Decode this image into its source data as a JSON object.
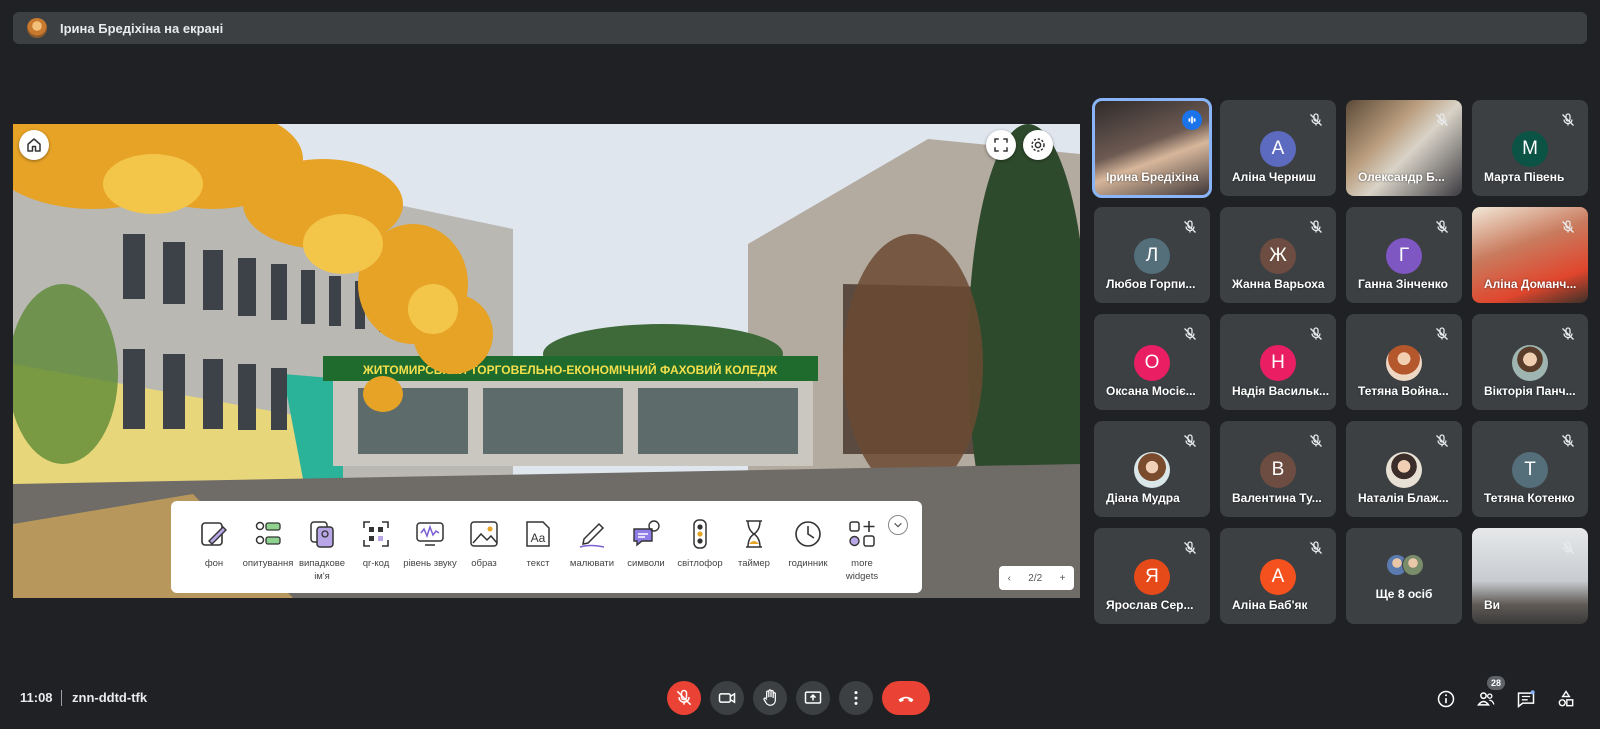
{
  "banner": {
    "presenter_text": "Ірина Бредіхіна на екрані"
  },
  "presentation": {
    "building_sign": "ЖИТОМИРСЬКИЙ ТОРГОВЕЛЬНО-ЕКОНОМІЧНИЙ ФАХОВИЙ КОЛЕДЖ",
    "toolbar": [
      {
        "label": "фон",
        "icon": "background-edit-icon"
      },
      {
        "label": "опитування",
        "icon": "poll-icon"
      },
      {
        "label": "випадкове ім'я",
        "icon": "random-name-icon"
      },
      {
        "label": "qr-код",
        "icon": "qr-code-icon"
      },
      {
        "label": "рівень звуку",
        "icon": "sound-level-icon"
      },
      {
        "label": "образ",
        "icon": "image-icon"
      },
      {
        "label": "текст",
        "icon": "text-icon"
      },
      {
        "label": "малювати",
        "icon": "draw-icon"
      },
      {
        "label": "символи",
        "icon": "symbols-icon"
      },
      {
        "label": "світлофор",
        "icon": "traffic-light-icon"
      },
      {
        "label": "таймер",
        "icon": "hourglass-icon"
      },
      {
        "label": "годинник",
        "icon": "clock-icon"
      },
      {
        "label": "more widgets",
        "icon": "more-widgets-icon"
      }
    ],
    "pager": {
      "prev": "‹",
      "page": "2/2",
      "next": "+"
    }
  },
  "participants": [
    {
      "name": "Ірина Бредіхіна",
      "type": "video",
      "speaking": true
    },
    {
      "name": "Аліна Черниш",
      "type": "letter",
      "letter": "А",
      "color": "#5c6bc0"
    },
    {
      "name": "Олександр Б...",
      "type": "video"
    },
    {
      "name": "Марта Півень",
      "type": "letter",
      "letter": "М",
      "color": "#0b5345"
    },
    {
      "name": "Любов Горпи...",
      "type": "letter",
      "letter": "Л",
      "color": "#546e7a"
    },
    {
      "name": "Жанна Варьоха",
      "type": "letter",
      "letter": "Ж",
      "color": "#6d4c41"
    },
    {
      "name": "Ганна Зінченко",
      "type": "letter",
      "letter": "Г",
      "color": "#7e57c2"
    },
    {
      "name": "Аліна Доманч...",
      "type": "video"
    },
    {
      "name": "Оксана Мосіє...",
      "type": "letter",
      "letter": "О",
      "color": "#e91e63"
    },
    {
      "name": "Надія Васильк...",
      "type": "letter",
      "letter": "Н",
      "color": "#e91e63"
    },
    {
      "name": "Тетяна Война...",
      "type": "photo"
    },
    {
      "name": "Вікторія Панч...",
      "type": "photo"
    },
    {
      "name": "Діана Мудра",
      "type": "photo"
    },
    {
      "name": "Валентина Ту...",
      "type": "letter",
      "letter": "В",
      "color": "#6d4c41"
    },
    {
      "name": "Наталія Блаж...",
      "type": "photo"
    },
    {
      "name": "Тетяна Котенко",
      "type": "letter",
      "letter": "Т",
      "color": "#546e7a"
    },
    {
      "name": "Ярослав Сер...",
      "type": "letter",
      "letter": "Я",
      "color": "#e64a19"
    },
    {
      "name": "Аліна Баб'як",
      "type": "letter",
      "letter": "А",
      "color": "#f4511e"
    },
    {
      "name": "Ще 8 осіб",
      "type": "more"
    },
    {
      "name": "Ви",
      "type": "video"
    }
  ],
  "bottom_bar": {
    "time": "11:08",
    "meeting_code": "znn-ddtd-tfk",
    "people_count": "28"
  },
  "colors": {
    "background": "#202124",
    "tile": "#3c4043",
    "accent": "#8ab4f8",
    "danger": "#ea4335"
  }
}
